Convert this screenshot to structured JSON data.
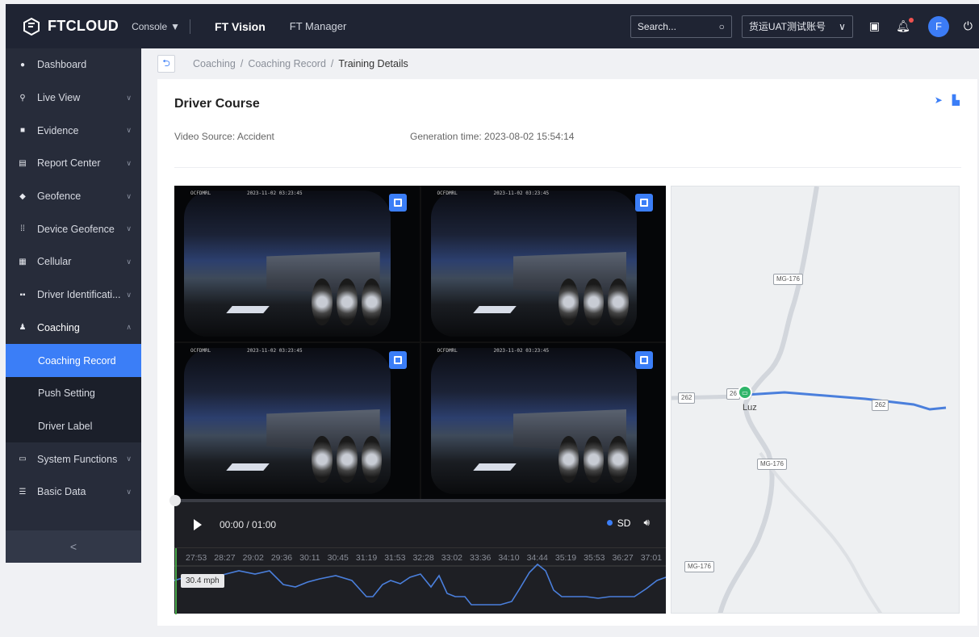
{
  "topbar": {
    "brand": "FTCLOUD",
    "console": "Console",
    "tabs": [
      "FT Vision",
      "FT Manager"
    ],
    "search_placeholder": "Search...",
    "account": "货运UAT测试账号",
    "avatar_letter": "F"
  },
  "sidebar": {
    "items": [
      {
        "label": "Dashboard",
        "icon": "dashboard-icon"
      },
      {
        "label": "Live View",
        "icon": "live-view-icon"
      },
      {
        "label": "Evidence",
        "icon": "evidence-icon"
      },
      {
        "label": "Report Center",
        "icon": "report-icon"
      },
      {
        "label": "Geofence",
        "icon": "geofence-icon"
      },
      {
        "label": "Device Geofence",
        "icon": "device-geofence-icon"
      },
      {
        "label": "Cellular",
        "icon": "cellular-icon"
      },
      {
        "label": "Driver Identificati...",
        "icon": "driver-id-icon"
      },
      {
        "label": "Coaching",
        "icon": "coaching-icon"
      },
      {
        "label": "System Functions",
        "icon": "system-icon"
      },
      {
        "label": "Basic Data",
        "icon": "basic-data-icon"
      }
    ],
    "sub_items": [
      "Coaching Record",
      "Push Setting",
      "Driver Label"
    ],
    "collapse_glyph": "<"
  },
  "breadcrumb": {
    "items": [
      "Coaching",
      "Coaching Record",
      "Training Details"
    ],
    "separator": "/"
  },
  "card": {
    "title": "Driver Course",
    "video_source": "Video Source: Accident",
    "generation_time": "Generation time: 2023-08-02 15:54:14"
  },
  "video": {
    "cam_text_a": "OCFDMRL",
    "cam_text_b": "2023-11-02 03:23:45",
    "time": "00:00 / 01:00",
    "quality": "SD",
    "progress": 0,
    "timeline_labels": [
      "27:53",
      "28:27",
      "29:02",
      "29:36",
      "30:11",
      "30:45",
      "31:19",
      "31:53",
      "32:28",
      "33:02",
      "33:36",
      "34:10",
      "34:44",
      "35:19",
      "35:53",
      "36:27",
      "37:01"
    ],
    "speed_tag": "30.4 mph"
  },
  "map": {
    "roads": [
      "MG-176",
      "262",
      "26",
      "MG-176",
      "MG-176",
      "262"
    ],
    "town": "Luz"
  },
  "colors": {
    "accent": "#3b7ef7",
    "topbar": "#1f2433",
    "sidebar": "#272c3a",
    "route": "#4a7fdc",
    "pin": "#2fb56a"
  }
}
